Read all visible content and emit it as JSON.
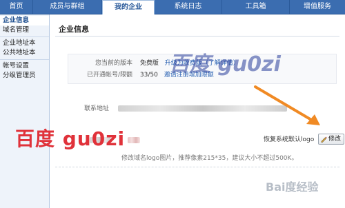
{
  "nav": {
    "tabs": [
      {
        "label": "首页"
      },
      {
        "label": "成员与群组"
      },
      {
        "label": "我的企业"
      },
      {
        "label": "系统日志"
      },
      {
        "label": "工具箱"
      },
      {
        "label": "增值服务"
      }
    ],
    "active": "我的企业"
  },
  "sidebar": {
    "groups": [
      [
        "企业信息",
        "域名管理"
      ],
      [
        "企业地址本",
        "公共地址本"
      ],
      [
        "帐号设置",
        "分级管理员"
      ]
    ]
  },
  "main": {
    "title": "企业信息",
    "plan_label": "您当前的版本",
    "plan_value": "免费版",
    "upgrade_link": "升级为收费版（了解详情）",
    "accounts_label": "已开通帐号/限额",
    "accounts_value": "33/50",
    "register_link": "邀请注册增加限额",
    "address_label": "联系地址",
    "restore_logo_link": "恢复系统默认logo",
    "modify_button": "修改",
    "logo_hint": "修改域名logo图片，推荐像素215*35，建议大小不超过500K。"
  },
  "watermarks": {
    "center": "百度 gu0zi",
    "left": "百度 gu0zi",
    "corner": "Bai度经验"
  },
  "colors": {
    "nav_bg": "#3b6db0",
    "link": "#2a62b3",
    "arrow": "#f08a24",
    "watermark_red": "#e0323a",
    "watermark_blue": "#2a3f9c"
  }
}
